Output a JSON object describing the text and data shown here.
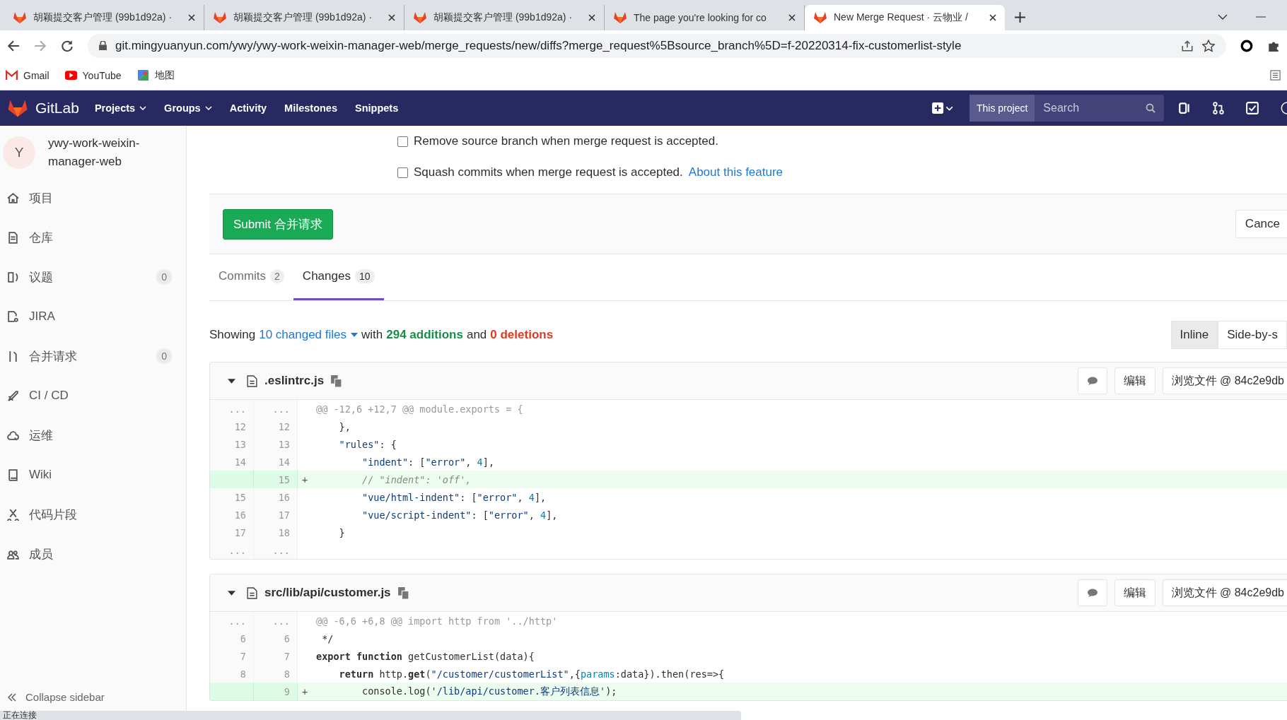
{
  "browser": {
    "tabs": [
      {
        "title": "胡颖提交客户管理 (99b1d92a) ·",
        "selected": false
      },
      {
        "title": "胡颖提交客户管理 (99b1d92a) ·",
        "selected": false
      },
      {
        "title": "胡颖提交客户管理 (99b1d92a) ·",
        "selected": false
      },
      {
        "title": "The page you're looking for co",
        "selected": false
      },
      {
        "title": "New Merge Request · 云物业 /",
        "selected": true
      }
    ],
    "url": "git.mingyuanyun.com/ywy/ywy-work-weixin-manager-web/merge_requests/new/diffs?merge_request%5Bsource_branch%5D=f-20220314-fix-customerlist-style",
    "bookmarks": [
      {
        "label": "Gmail",
        "kind": "gmail"
      },
      {
        "label": "YouTube",
        "kind": "youtube"
      },
      {
        "label": "地图",
        "kind": "maps"
      }
    ],
    "status": "正在连接"
  },
  "navbar": {
    "brand": "GitLab",
    "links": [
      {
        "label": "Projects",
        "dropdown": true
      },
      {
        "label": "Groups",
        "dropdown": true
      },
      {
        "label": "Activity",
        "dropdown": false
      },
      {
        "label": "Milestones",
        "dropdown": false
      },
      {
        "label": "Snippets",
        "dropdown": false
      }
    ],
    "scope": "This project",
    "search": {
      "placeholder": "Search"
    }
  },
  "sidebar": {
    "avatar": "Y",
    "project": "ywy-work-weixin-manager-web",
    "items": [
      {
        "label": "项目",
        "selected": false
      },
      {
        "label": "仓库",
        "selected": false
      },
      {
        "label": "议题",
        "count": "0",
        "selected": false
      },
      {
        "label": "JIRA",
        "selected": false
      },
      {
        "label": "合并请求",
        "count": "0",
        "selected": false
      },
      {
        "label": "CI / CD",
        "selected": false
      },
      {
        "label": "运维",
        "selected": false
      },
      {
        "label": "Wiki",
        "selected": false
      },
      {
        "label": "代码片段",
        "selected": false
      },
      {
        "label": "成员",
        "selected": false
      }
    ],
    "collapse": "Collapse sidebar"
  },
  "options": [
    {
      "label": "Remove source branch when merge request is accepted.",
      "checked": false
    },
    {
      "label": "Squash commits when merge request is accepted.",
      "checked": false,
      "link": "About this feature"
    }
  ],
  "submit": "Submit 合并请求",
  "cancel": "Cance",
  "tabs": [
    {
      "label": "Commits",
      "count": "2",
      "selected": false
    },
    {
      "label": "Changes",
      "count": "10",
      "selected": true
    }
  ],
  "summary": {
    "prefix": "Showing",
    "files": "10 changed files",
    "middle": "with",
    "additions": "294 additions",
    "and": "and",
    "deletions": "0 deletions"
  },
  "views": [
    {
      "label": "Inline",
      "selected": true
    },
    {
      "label": "Side-by-s",
      "selected": false
    }
  ],
  "files": [
    {
      "name": ".eslintrc.js",
      "edit": "编辑",
      "view": "浏览文件 @ 84c2e9db",
      "expanded": true,
      "lines": [
        {
          "kind": "meta",
          "old": "...",
          "new": "...",
          "tokens": [
            {
              "text": "@@ -12,6 +12,7 @@ module.exports = {",
              "kind": "plain"
            }
          ]
        },
        {
          "kind": "context",
          "old": "12",
          "new": "12",
          "tokens": [
            {
              "text": "    },",
              "kind": "plain"
            }
          ]
        },
        {
          "kind": "context",
          "old": "13",
          "new": "13",
          "tokens": [
            {
              "text": "    \"rules\"",
              "kind": "str"
            },
            {
              "text": ": {",
              "kind": "plain"
            }
          ]
        },
        {
          "kind": "context",
          "old": "14",
          "new": "14",
          "tokens": [
            {
              "text": "        \"indent\"",
              "kind": "str"
            },
            {
              "text": ": [",
              "kind": "plain"
            },
            {
              "text": "\"error\"",
              "kind": "str"
            },
            {
              "text": ", ",
              "kind": "plain"
            },
            {
              "text": "4",
              "kind": "num"
            },
            {
              "text": "],",
              "kind": "plain"
            }
          ]
        },
        {
          "kind": "add",
          "new": "15",
          "sign": "+",
          "tokens": [
            {
              "text": "        // \"indent\": 'off',",
              "kind": "comment"
            }
          ]
        },
        {
          "kind": "context",
          "old": "15",
          "new": "16",
          "tokens": [
            {
              "text": "        \"vue/html-indent\"",
              "kind": "str"
            },
            {
              "text": ": [",
              "kind": "plain"
            },
            {
              "text": "\"error\"",
              "kind": "str"
            },
            {
              "text": ", ",
              "kind": "plain"
            },
            {
              "text": "4",
              "kind": "num"
            },
            {
              "text": "],",
              "kind": "plain"
            }
          ]
        },
        {
          "kind": "context",
          "old": "16",
          "new": "17",
          "tokens": [
            {
              "text": "        \"vue/script-indent\"",
              "kind": "str"
            },
            {
              "text": ": [",
              "kind": "plain"
            },
            {
              "text": "\"error\"",
              "kind": "str"
            },
            {
              "text": ", ",
              "kind": "plain"
            },
            {
              "text": "4",
              "kind": "num"
            },
            {
              "text": "],",
              "kind": "plain"
            }
          ]
        },
        {
          "kind": "context",
          "old": "17",
          "new": "18",
          "tokens": [
            {
              "text": "    }",
              "kind": "plain"
            }
          ]
        },
        {
          "kind": "meta",
          "old": "...",
          "new": "..."
        }
      ]
    },
    {
      "name": "src/lib/api/customer.js",
      "edit": "编辑",
      "view": "浏览文件 @ 84c2e9db",
      "expanded": true,
      "lines": [
        {
          "kind": "meta",
          "old": "...",
          "new": "...",
          "tokens": [
            {
              "text": "@@ -6,6 +6,8 @@ import http from '../http'",
              "kind": "plain"
            }
          ]
        },
        {
          "kind": "context",
          "old": "6",
          "new": "6",
          "tokens": [
            {
              "text": " */",
              "kind": "plain"
            }
          ]
        },
        {
          "kind": "context",
          "old": "7",
          "new": "7",
          "tokens": [
            {
              "text": "export function",
              "kind": "kw"
            },
            {
              "text": " getCustomerList(data){",
              "kind": "plain"
            }
          ]
        },
        {
          "kind": "context",
          "old": "8",
          "new": "8",
          "tokens": [
            {
              "text": "    return",
              "kind": "kw"
            },
            {
              "text": " http.",
              "kind": "plain"
            },
            {
              "text": "get",
              "kind": "kw"
            },
            {
              "text": "(",
              "kind": "plain"
            },
            {
              "text": "\"/customer/customerList\"",
              "kind": "str"
            },
            {
              "text": ",{",
              "kind": "plain"
            },
            {
              "text": "params",
              "kind": "num"
            },
            {
              "text": ":data}).then(res=>{",
              "kind": "plain"
            }
          ]
        },
        {
          "kind": "add",
          "new": "9",
          "sign": "+",
          "tokens": [
            {
              "text": "        console.log(",
              "kind": "plain"
            },
            {
              "text": "'/lib/api/customer.客户列表信息'",
              "kind": "str"
            },
            {
              "text": ");",
              "kind": "plain"
            }
          ]
        }
      ]
    }
  ]
}
